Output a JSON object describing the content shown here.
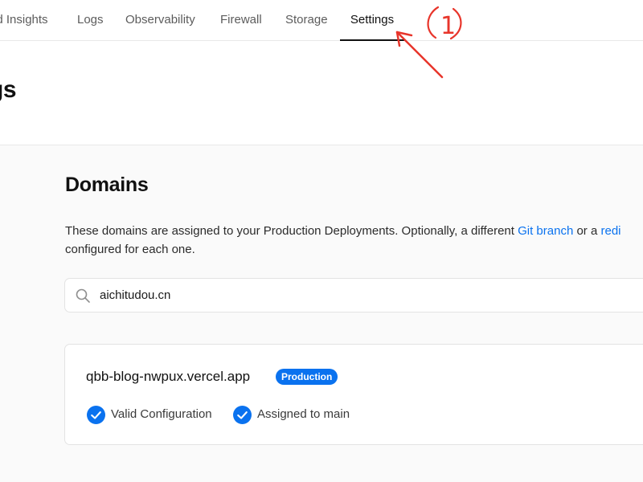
{
  "nav": {
    "tabs": [
      {
        "label": "ed Insights"
      },
      {
        "label": "Logs"
      },
      {
        "label": "Observability"
      },
      {
        "label": "Firewall"
      },
      {
        "label": "Storage"
      },
      {
        "label": "Settings",
        "active": true
      }
    ]
  },
  "header": {
    "title": "gs"
  },
  "domains": {
    "title": "Domains",
    "description_text_1": "These domains are assigned to your Production Deployments. Optionally, a different ",
    "description_link_1": "Git branch",
    "description_text_2": " or a ",
    "description_link_2": "redi",
    "description_text_3": "configured for each one.",
    "search": {
      "value": "aichitudou.cn",
      "icon": "search-icon"
    },
    "items": [
      {
        "name": "qbb-blog-nwpux.vercel.app",
        "badge": "Production",
        "statuses": [
          {
            "label": "Valid Configuration",
            "icon": "check-circle-icon"
          },
          {
            "label": "Assigned to main",
            "icon": "check-circle-icon"
          }
        ]
      }
    ]
  },
  "annotation": {
    "label": "1",
    "color": "#e8352b"
  },
  "colors": {
    "accent": "#0a72ef",
    "background": "#fafafa",
    "surface": "#ffffff",
    "border": "#e3e3e3"
  }
}
